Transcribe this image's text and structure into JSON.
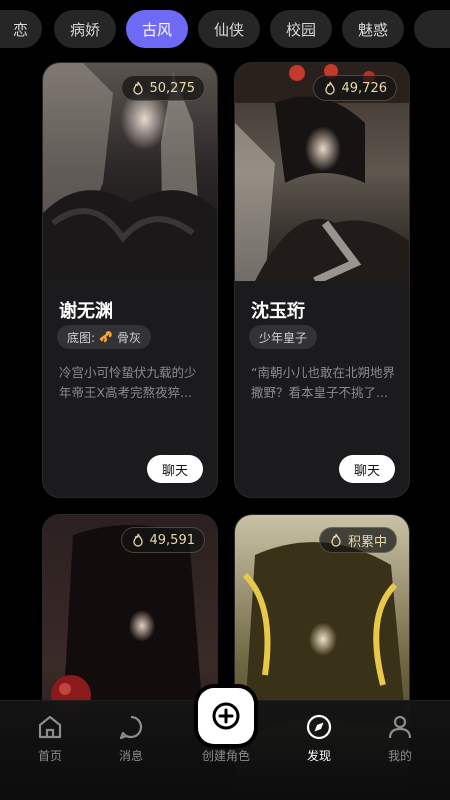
{
  "categories": [
    {
      "label": "恋",
      "active": false
    },
    {
      "label": "病娇",
      "active": false
    },
    {
      "label": "古风",
      "active": true
    },
    {
      "label": "仙侠",
      "active": false
    },
    {
      "label": "校园",
      "active": false
    },
    {
      "label": "魅惑",
      "active": false
    },
    {
      "label": "",
      "active": false
    }
  ],
  "cards": [
    {
      "heat": "50,275",
      "name": "谢无渊",
      "tag_prefix": "底图:",
      "tag": "骨灰",
      "desc_line1": "冷宫小可怜蛰伏九载的少",
      "desc_line2": "年帝王X高考完熬夜猝...",
      "chat_label": "聊天"
    },
    {
      "heat": "49,726",
      "name": "沈玉珩",
      "tag": "少年皇子",
      "desc_line1": "“南朝小儿也敢在北朔地界",
      "desc_line2": "撒野？看本皇子不挑了...",
      "chat_label": "聊天"
    },
    {
      "heat": "49,591"
    },
    {
      "heat": "积累中"
    }
  ],
  "nav": {
    "home": "首页",
    "messages": "消息",
    "create": "创建角色",
    "discover": "发现",
    "profile": "我的"
  },
  "colors": {
    "accent": "#6f6af5",
    "badge_text": "#e9d9a9",
    "card_bg": "#1b1b1d"
  }
}
